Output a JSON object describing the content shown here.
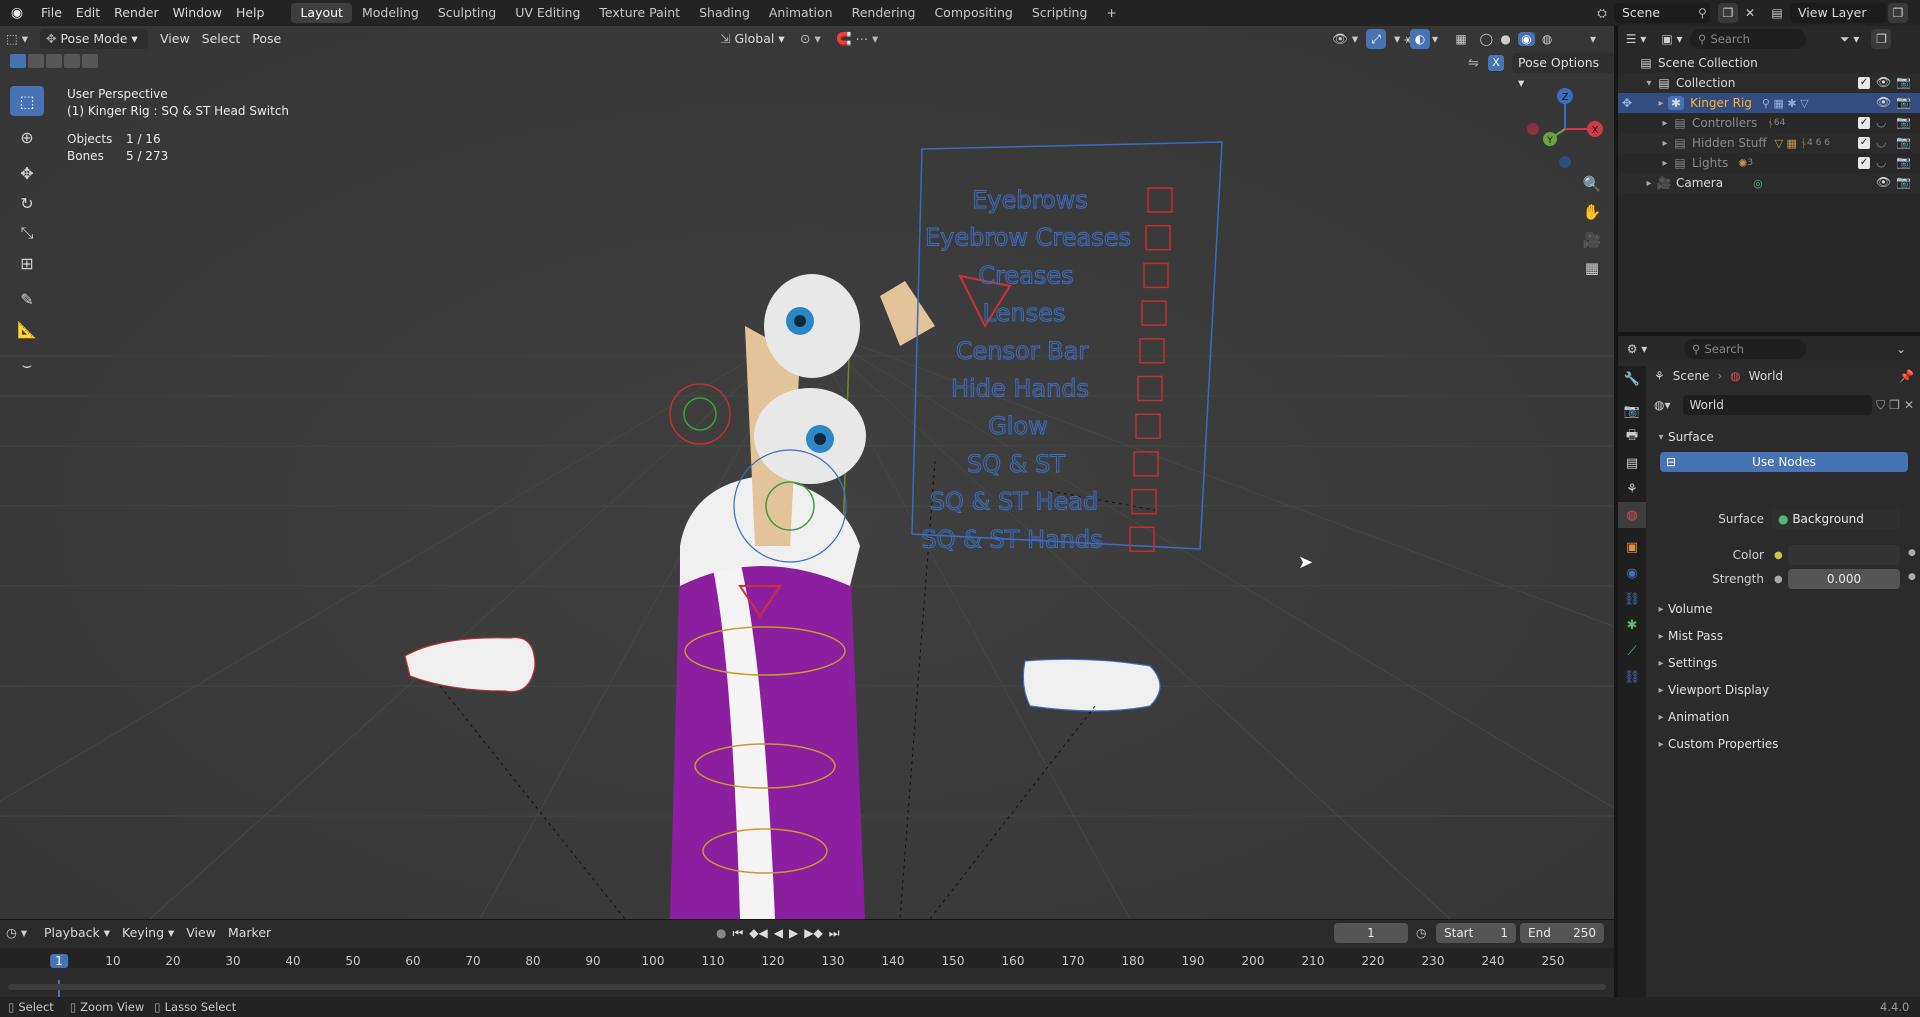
{
  "topbar": {
    "menus": [
      "File",
      "Edit",
      "Render",
      "Window",
      "Help"
    ],
    "workspaces": [
      "Layout",
      "Modeling",
      "Sculpting",
      "UV Editing",
      "Texture Paint",
      "Shading",
      "Animation",
      "Rendering",
      "Compositing",
      "Scripting"
    ],
    "add_tab": "+",
    "scene": "Scene",
    "view_layer": "View Layer"
  },
  "viewport": {
    "mode": "Pose Mode",
    "menus": [
      "View",
      "Select",
      "Pose"
    ],
    "orientation": "Global",
    "pose_options": "Pose Options",
    "x_mirror": "X",
    "perspective": "User Perspective",
    "active": "(1) Kinger Rig : SQ & ST Head Switch",
    "objects_label": "Objects",
    "objects_value": "1 / 16",
    "bones_label": "Bones",
    "bones_value": "5 / 273",
    "gizmo": {
      "z": "Z",
      "y": "Y",
      "x": "X"
    },
    "switch_labels": [
      "Eyebrows",
      "Eyebrow Creases",
      "Creases",
      "Lenses",
      "Censor Bar",
      "Hide Hands",
      "Glow",
      "SQ & ST",
      "SQ & ST Head",
      "SQ & ST Hands"
    ]
  },
  "timeline": {
    "menus": [
      "Playback",
      "Keying",
      "View",
      "Marker"
    ],
    "current_frame": "1",
    "start_label": "Start",
    "start": "1",
    "end_label": "End",
    "end": "250",
    "ticks": [
      "1",
      "10",
      "20",
      "30",
      "40",
      "50",
      "60",
      "70",
      "80",
      "90",
      "100",
      "110",
      "120",
      "130",
      "140",
      "150",
      "160",
      "170",
      "180",
      "190",
      "200",
      "210",
      "220",
      "230",
      "240",
      "250"
    ]
  },
  "status": {
    "select": "Select",
    "zoom": "Zoom View",
    "lasso": "Lasso Select",
    "version": "4.4.0"
  },
  "outliner": {
    "search_placeholder": "Search",
    "root": "Scene Collection",
    "collection": "Collection",
    "items": [
      {
        "name": "Kinger Rig"
      },
      {
        "name": "Controllers",
        "badge": "64"
      },
      {
        "name": "Hidden Stuff",
        "badge": "4 6 6"
      },
      {
        "name": "Lights",
        "badge": "3"
      },
      {
        "name": "Camera"
      }
    ]
  },
  "properties": {
    "search_placeholder": "Search",
    "breadcrumb_scene": "Scene",
    "breadcrumb_world": "World",
    "world_name": "World",
    "surface_panel": "Surface",
    "use_nodes": "Use Nodes",
    "surface_label": "Surface",
    "surface_value": "Background",
    "color_label": "Color",
    "strength_label": "Strength",
    "strength_value": "0.000",
    "panels": [
      "Volume",
      "Mist Pass",
      "Settings",
      "Viewport Display",
      "Animation",
      "Custom Properties"
    ]
  }
}
